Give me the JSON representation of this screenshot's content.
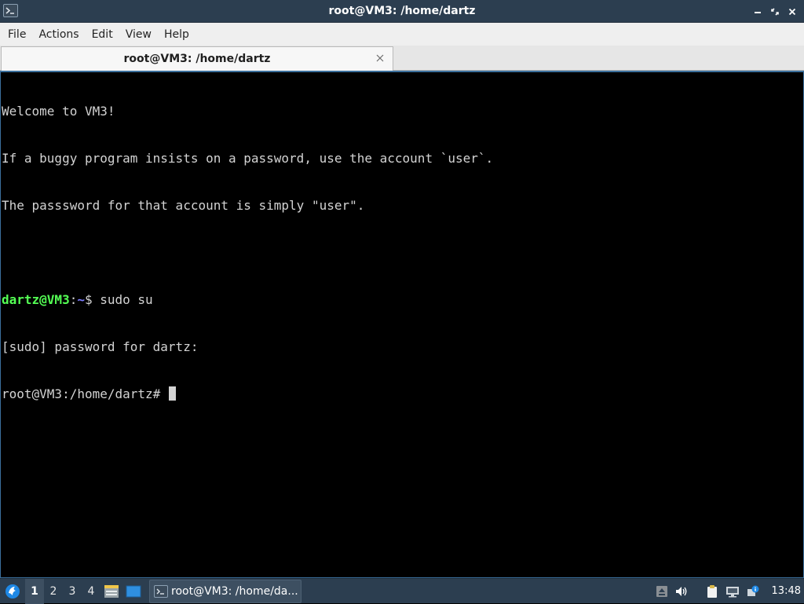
{
  "window": {
    "title": "root@VM3: /home/dartz"
  },
  "menubar": {
    "items": [
      {
        "label": "File"
      },
      {
        "label": "Actions"
      },
      {
        "label": "Edit"
      },
      {
        "label": "View"
      },
      {
        "label": "Help"
      }
    ]
  },
  "tabs": [
    {
      "label": "root@VM3: /home/dartz",
      "active": true
    }
  ],
  "terminal": {
    "lines": [
      "Welcome to VM3!",
      "If a buggy program insists on a password, use the account `user`.",
      "The passsword for that account is simply \"user\".",
      ""
    ],
    "prompt": {
      "user_host": "dartz@VM3",
      "separator": ":",
      "path": "~",
      "symbol": "$ ",
      "command": "sudo su"
    },
    "sudo_line": "[sudo] password for dartz:",
    "root_prompt": "root@VM3:/home/dartz# "
  },
  "taskbar": {
    "workspaces": [
      "1",
      "2",
      "3",
      "4"
    ],
    "active_workspace": "1",
    "task_label": "root@VM3: /home/da...",
    "clock": "13:48"
  },
  "icons": {
    "window_icon": "terminal-icon",
    "minimize": "minimize-icon",
    "maximize": "restore-icon",
    "close": "close-icon",
    "start": "lxqt-start-icon",
    "tray": [
      "upload-icon",
      "volume-icon",
      "clipboard-icon",
      "network-icon"
    ]
  },
  "colors": {
    "titlebar": "#2c3e50",
    "terminal_bg": "#000000",
    "terminal_fg": "#d3d3d3",
    "prompt_user": "#54ff54",
    "prompt_path": "#7c7cff",
    "accent_border": "#3b6f9c"
  }
}
